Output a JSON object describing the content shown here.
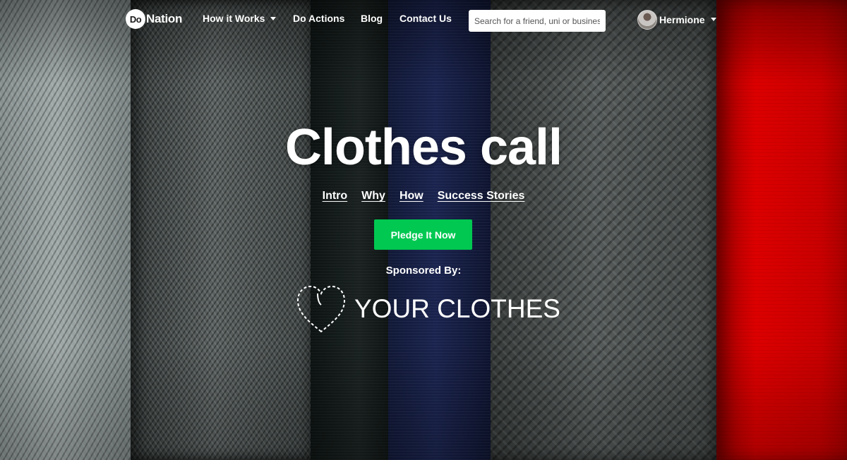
{
  "logo": {
    "do": "Do",
    "nation": "Nation"
  },
  "nav": {
    "how_it_works": "How it Works",
    "do_actions": "Do Actions",
    "blog": "Blog",
    "contact_us": "Contact Us",
    "search_placeholder": "Search for a friend, uni or business",
    "user_name": "Hermione"
  },
  "hero": {
    "title": "Clothes call",
    "subnav": [
      "Intro",
      "Why",
      "How",
      "Success Stories"
    ],
    "pledge_button": "Pledge It Now",
    "sponsored_by": "Sponsored By:",
    "sponsor_name": "YOUR CLOTHES"
  },
  "colors": {
    "pledge_green": "#00c851",
    "red_fabric": "#e80000"
  }
}
